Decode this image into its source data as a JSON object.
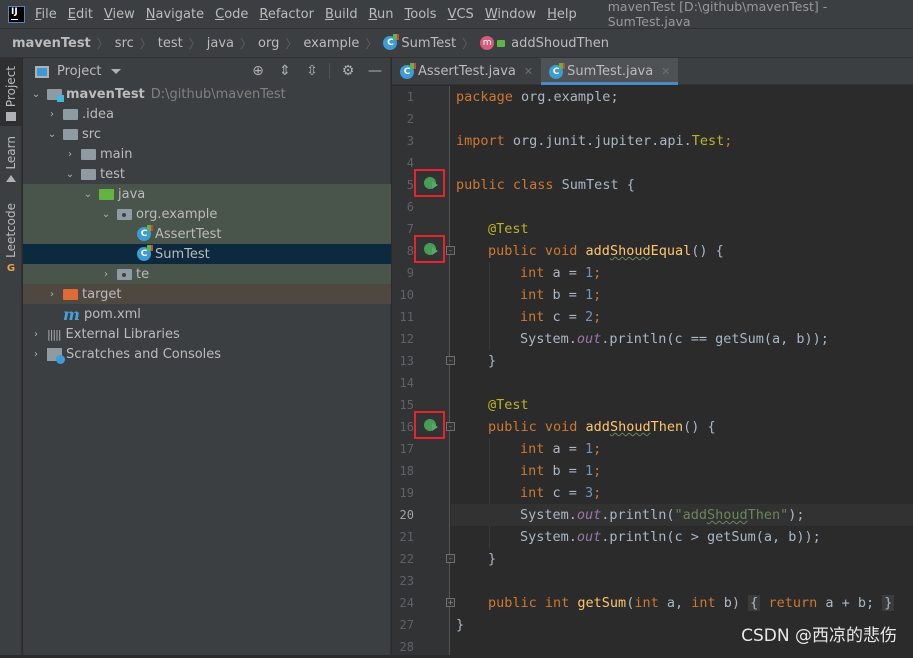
{
  "menubar": {
    "items": [
      "File",
      "Edit",
      "View",
      "Navigate",
      "Code",
      "Refactor",
      "Build",
      "Run",
      "Tools",
      "VCS",
      "Window",
      "Help"
    ],
    "window_title": "mavenTest [D:\\github\\mavenTest] - SumTest.java"
  },
  "breadcrumb": {
    "project": "mavenTest",
    "parts": [
      "src",
      "test",
      "java",
      "org",
      "example"
    ],
    "class": "SumTest",
    "method": "addShoudThen"
  },
  "toolstrip": {
    "tabs": [
      "Project",
      "Learn",
      "Leetcode"
    ]
  },
  "project_panel": {
    "title": "Project",
    "tree": [
      {
        "label": "mavenTest",
        "hint": "D:\\github\\mavenTest"
      },
      {
        "label": ".idea"
      },
      {
        "label": "src"
      },
      {
        "label": "main"
      },
      {
        "label": "test"
      },
      {
        "label": "java"
      },
      {
        "label": "org.example"
      },
      {
        "label": "AssertTest"
      },
      {
        "label": "SumTest"
      },
      {
        "label": "te"
      },
      {
        "label": "target"
      },
      {
        "label": "pom.xml"
      },
      {
        "label": "External Libraries"
      },
      {
        "label": "Scratches and Consoles"
      }
    ]
  },
  "editor": {
    "tabs": [
      {
        "label": "AssertTest.java",
        "active": false
      },
      {
        "label": "SumTest.java",
        "active": true
      }
    ],
    "line_numbers": [
      "1",
      "2",
      "3",
      "4",
      "5",
      "6",
      "7",
      "8",
      "9",
      "10",
      "11",
      "12",
      "13",
      "14",
      "15",
      "16",
      "17",
      "18",
      "19",
      "20",
      "21",
      "22",
      "23",
      "24",
      "27",
      "28"
    ],
    "current_line": "20",
    "code": {
      "l1": {
        "kw": "package",
        "rest": " org.example;"
      },
      "l3": {
        "kw": "import",
        "rest": " org.junit.jupiter.api.",
        "cls": "Test",
        "end": ";"
      },
      "l5": {
        "kw": "public class",
        "rest": " SumTest {"
      },
      "l7": {
        "ann": "@Test"
      },
      "l8": {
        "kw": "public void",
        "fn_a": "add",
        "fn_b": "Shoud",
        "fn_c": "Equal",
        "rest": "() {"
      },
      "l9": {
        "kw": "int",
        "rest": " a = ",
        "num": "1",
        "end": ";"
      },
      "l10": {
        "kw": "int",
        "rest": " b = ",
        "num": "1",
        "end": ";"
      },
      "l11": {
        "kw": "int",
        "rest": " c = ",
        "num": "2",
        "end": ";"
      },
      "l12": {
        "a": "System.",
        "stat": "out",
        "b": ".println(c == getSum(a, b));"
      },
      "l13": {
        "rest": "}"
      },
      "l15": {
        "ann": "@Test"
      },
      "l16": {
        "kw": "public void",
        "fn_a": "add",
        "fn_b": "Shoud",
        "fn_c": "Then",
        "rest": "() {"
      },
      "l17": {
        "kw": "int",
        "rest": " a = ",
        "num": "1",
        "end": ";"
      },
      "l18": {
        "kw": "int",
        "rest": " b = ",
        "num": "1",
        "end": ";"
      },
      "l19": {
        "kw": "int",
        "rest": " c = ",
        "num": "3",
        "end": ";"
      },
      "l20": {
        "a": "System.",
        "stat": "out",
        "b": ".println(",
        "str_a": "\"add",
        "str_b": "Shoud",
        "str_c": "Then\"",
        "c": ");"
      },
      "l21": {
        "a": "System.",
        "stat": "out",
        "b": ".println(c > getSum(a, b));"
      },
      "l22": {
        "rest": "}"
      },
      "l24": {
        "kw": "public int",
        "fn": "getSum",
        "p1": "(",
        "kw2": "int",
        "p2": " a, ",
        "kw3": "int",
        "p3": " b) ",
        "fold_open": "{",
        "kw4": "return",
        "body": " a + b;",
        "fold_close": "}"
      },
      "l27": {
        "rest": "}"
      }
    }
  },
  "watermark": "CSDN @西凉的悲伤"
}
